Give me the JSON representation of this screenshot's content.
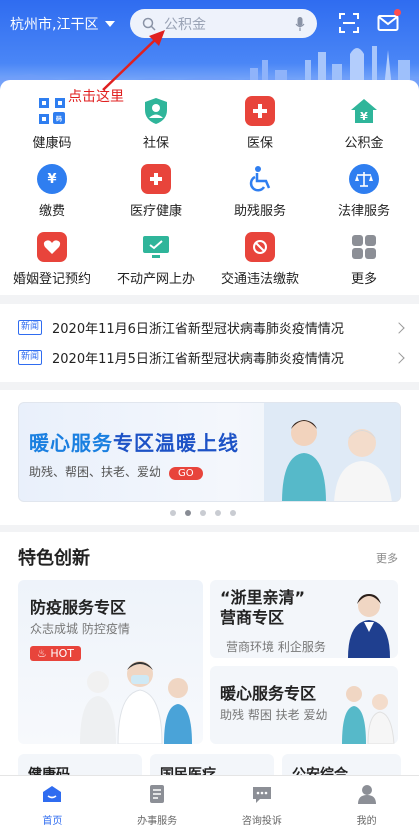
{
  "header": {
    "location": "杭州市,江干区",
    "search_placeholder": "公积金"
  },
  "annotation": "点击这里",
  "services": [
    {
      "label": "健康码",
      "icon": "qr-health-code-icon"
    },
    {
      "label": "社保",
      "icon": "shield-check-icon"
    },
    {
      "label": "医保",
      "icon": "medical-kit-icon"
    },
    {
      "label": "公积金",
      "icon": "house-yen-icon"
    },
    {
      "label": "缴费",
      "icon": "yen-coin-icon"
    },
    {
      "label": "医疗健康",
      "icon": "first-aid-icon"
    },
    {
      "label": "助残服务",
      "icon": "wheelchair-icon"
    },
    {
      "label": "法律服务",
      "icon": "scales-icon"
    },
    {
      "label": "婚姻登记预约",
      "icon": "heart-calendar-icon"
    },
    {
      "label": "不动产网上办",
      "icon": "monitor-icon"
    },
    {
      "label": "交通违法缴款",
      "icon": "traffic-fine-icon"
    },
    {
      "label": "更多",
      "icon": "grid-more-icon"
    }
  ],
  "news": {
    "tag": "新闻",
    "items": [
      "2020年11月6日浙江省新型冠状病毒肺炎疫情情况",
      "2020年11月5日浙江省新型冠状病毒肺炎疫情情况"
    ]
  },
  "banner": {
    "title_highlight": "暖心服务",
    "title_rest": "专区温暖上线",
    "subtitle": "助残、帮困、扶老、爱幼",
    "go_label": "GO",
    "page_count": 5,
    "active_page": 2
  },
  "features": {
    "title": "特色创新",
    "more_label": "更多",
    "tiles": [
      {
        "title": "防疫服务专区",
        "subtitle": "众志成城  防控疫情",
        "badge": "HOT"
      },
      {
        "title": "“浙里亲清”\n营商专区",
        "subtitle": "营商环境  利企服务"
      },
      {
        "title": "暖心服务专区",
        "subtitle": "助残  帮困  扶老  爱幼"
      }
    ],
    "peek": [
      "健康码",
      "国民医疗",
      "公安综合"
    ]
  },
  "tabbar": [
    {
      "label": "首页",
      "active": true
    },
    {
      "label": "办事服务",
      "active": false
    },
    {
      "label": "咨询投诉",
      "active": false
    },
    {
      "label": "我的",
      "active": false
    }
  ],
  "colors": {
    "brand_blue": "#2f6cf0",
    "hot_red": "#e8443b"
  }
}
